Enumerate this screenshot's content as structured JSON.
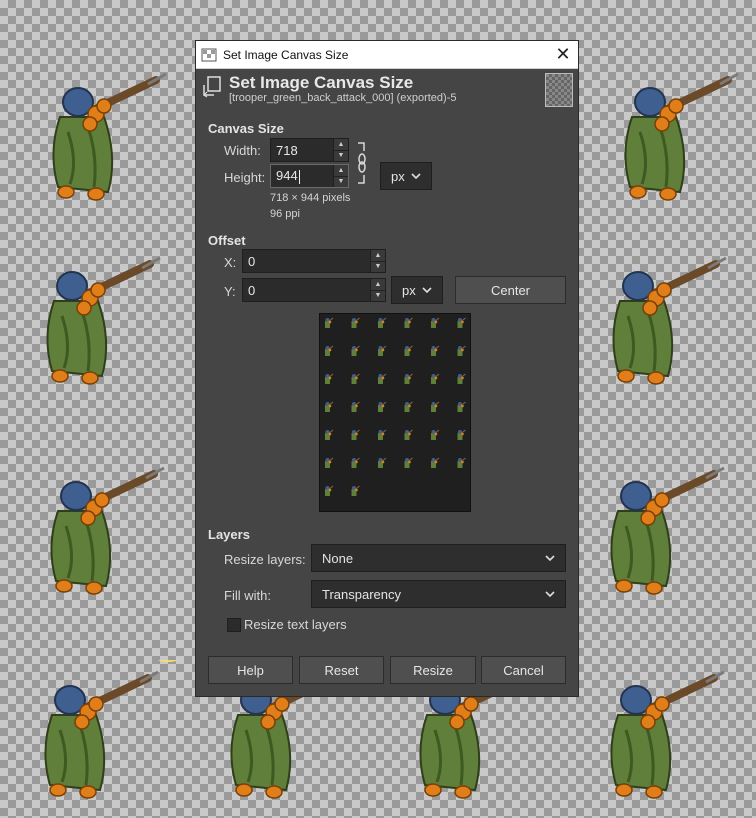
{
  "window": {
    "title": "Set Image Canvas Size",
    "header_title": "Set Image Canvas Size",
    "header_subtitle": "[trooper_green_back_attack_000] (exported)-5",
    "close_glyph": "✕"
  },
  "canvas_size": {
    "section_label": "Canvas Size",
    "width_label": "Width:",
    "width_value": "718",
    "height_label": "Height:",
    "height_value": "944",
    "unit": "px",
    "size_info": "718 × 944 pixels",
    "resolution_info": "96 ppi",
    "chain_icon": "chain-link-icon"
  },
  "offset": {
    "section_label": "Offset",
    "x_label": "X:",
    "x_value": "0",
    "y_label": "Y:",
    "y_value": "0",
    "unit": "px",
    "center_button": "Center"
  },
  "layers": {
    "section_label": "Layers",
    "resize_layers_label": "Resize layers:",
    "resize_layers_value": "None",
    "fill_with_label": "Fill with:",
    "fill_with_value": "Transparency",
    "resize_text_layers_label": "Resize text layers",
    "resize_text_layers_checked": false
  },
  "buttons": {
    "help": "Help",
    "reset": "Reset",
    "resize": "Resize",
    "cancel": "Cancel"
  },
  "colors": {
    "dialog_bg": "#454545",
    "field_bg": "#2b2b2b",
    "button_bg": "#4f4f4f"
  }
}
